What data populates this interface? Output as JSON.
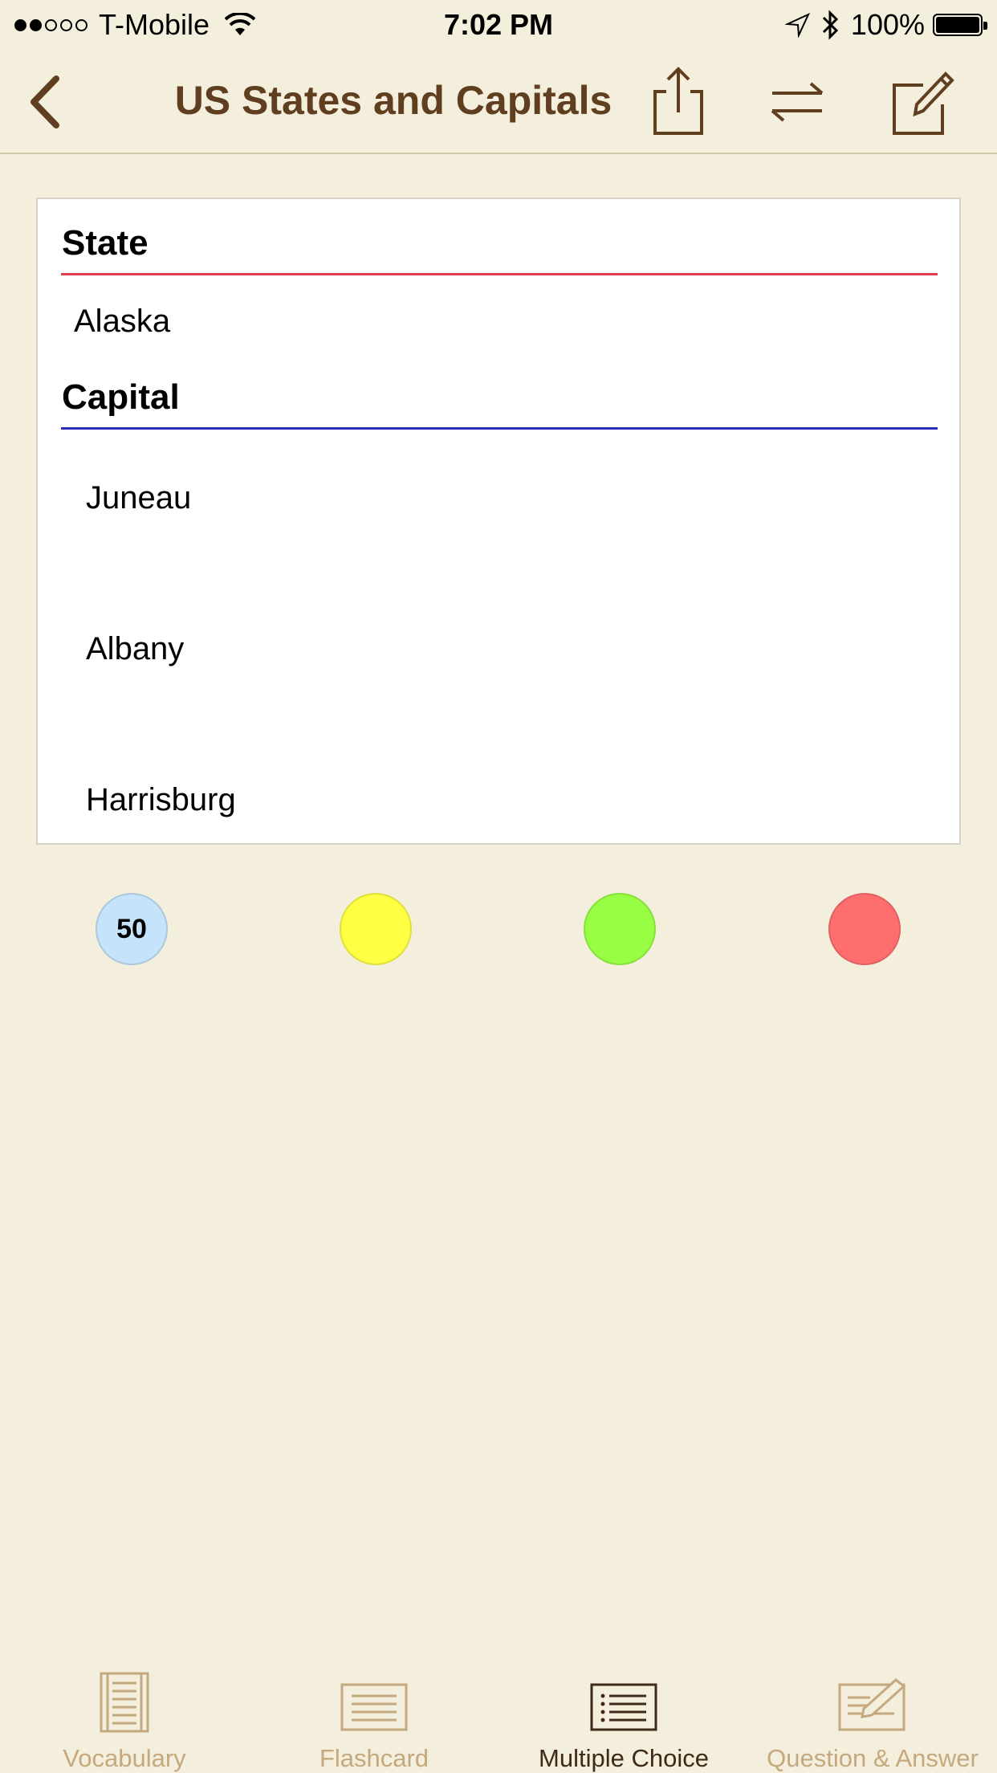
{
  "status_bar": {
    "carrier": "T-Mobile",
    "time": "7:02 PM",
    "battery": "100%",
    "signal_bars_filled": 2,
    "signal_bars_total": 5
  },
  "nav": {
    "title": "US States and Capitals",
    "back_icon": "chevron-left-icon",
    "share_icon": "share-icon",
    "swap_icon": "swap-arrows-icon",
    "edit_icon": "compose-icon"
  },
  "card": {
    "question_heading": "State",
    "question": "Alaska",
    "answer_heading": "Capital",
    "choices": [
      "Juneau",
      "Albany",
      "Harrisburg"
    ]
  },
  "circles": [
    {
      "color": "#c5e4fb",
      "label": "50"
    },
    {
      "color": "#ffff44",
      "label": ""
    },
    {
      "color": "#99ff44",
      "label": ""
    },
    {
      "color": "#ff6e6e",
      "label": ""
    }
  ],
  "tabs": [
    {
      "label": "Vocabulary",
      "icon": "vocabulary-icon",
      "active": false
    },
    {
      "label": "Flashcard",
      "icon": "flashcard-icon",
      "active": false
    },
    {
      "label": "Multiple Choice",
      "icon": "multiple-choice-icon",
      "active": true
    },
    {
      "label": "Question & Answer",
      "icon": "question-answer-icon",
      "active": false
    }
  ],
  "colors": {
    "background": "#f4eedd",
    "title": "#603e20",
    "state_rule": "#e0414d",
    "capital_rule": "#2d2dbd",
    "tab_inactive": "#c4a97e",
    "tab_active": "#3e2a16"
  }
}
